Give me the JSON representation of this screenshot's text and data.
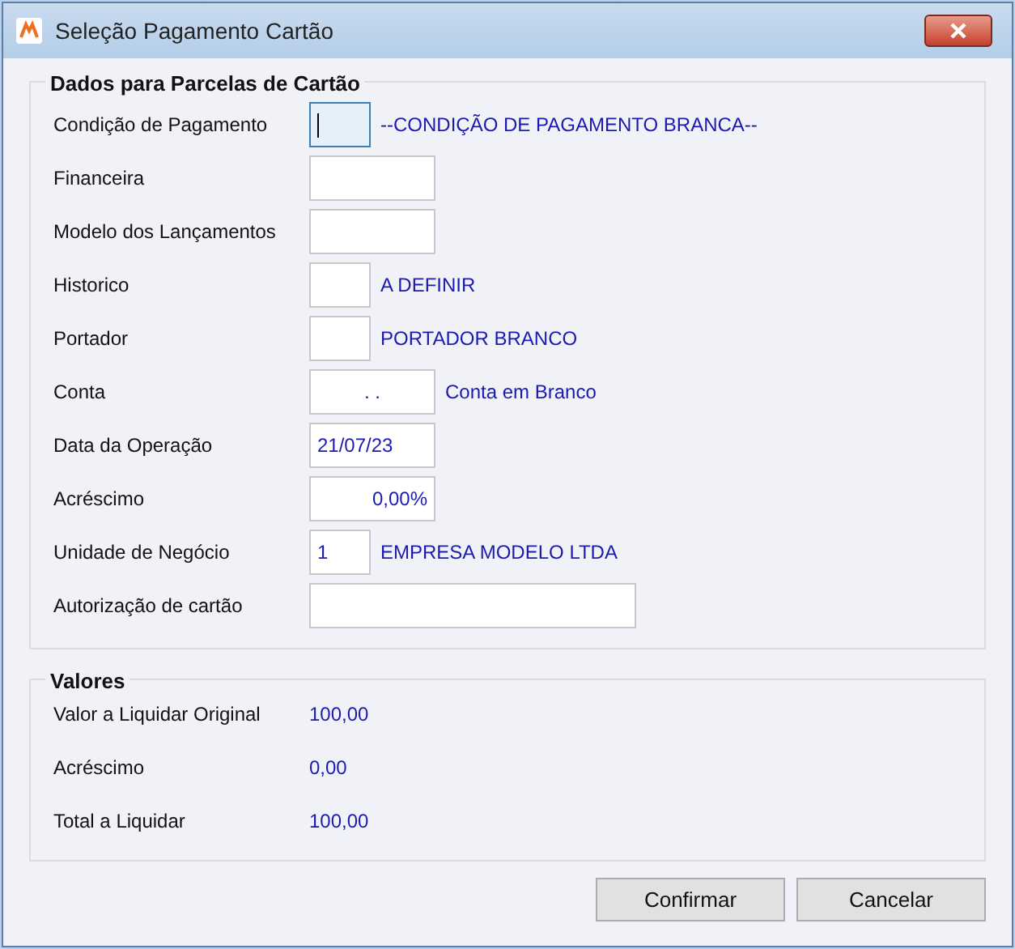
{
  "window": {
    "title": "Seleção Pagamento Cartão"
  },
  "card_group": {
    "title": "Dados para Parcelas de Cartão",
    "fields": [
      {
        "label": "Condição de Pagamento",
        "kind": "code",
        "focused": true,
        "description": "--CONDIÇÃO DE PAGAMENTO BRANCA--"
      },
      {
        "label": "Financeira",
        "kind": "text",
        "focused": false
      },
      {
        "label": "Modelo dos Lançamentos",
        "kind": "text",
        "focused": false
      },
      {
        "label": "Historico",
        "kind": "code",
        "focused": false,
        "description": "A DEFINIR"
      },
      {
        "label": "Portador",
        "kind": "code",
        "focused": false,
        "description": "PORTADOR BRANCO"
      },
      {
        "label": "Conta",
        "kind": "account",
        "focused": false,
        "value": ". .",
        "description": "Conta em Branco"
      },
      {
        "label": "Data da Operação",
        "kind": "text",
        "focused": false,
        "value": "21/07/23"
      },
      {
        "label": "Acréscimo",
        "kind": "percent",
        "focused": false,
        "value": "0,00%"
      },
      {
        "label": "Unidade de Negócio",
        "kind": "code",
        "focused": false,
        "value": "1",
        "description": "EMPRESA MODELO LTDA"
      },
      {
        "label": "Autorização de cartão",
        "kind": "long",
        "focused": false
      }
    ]
  },
  "values_group": {
    "title": "Valores",
    "rows": [
      {
        "label": "Valor a Liquidar Original",
        "value": "100,00"
      },
      {
        "label": "Acréscimo",
        "value": "0,00"
      },
      {
        "label": "Total a Liquidar",
        "value": "100,00"
      }
    ]
  },
  "buttons": [
    "Confirmar",
    "Cancelar"
  ]
}
